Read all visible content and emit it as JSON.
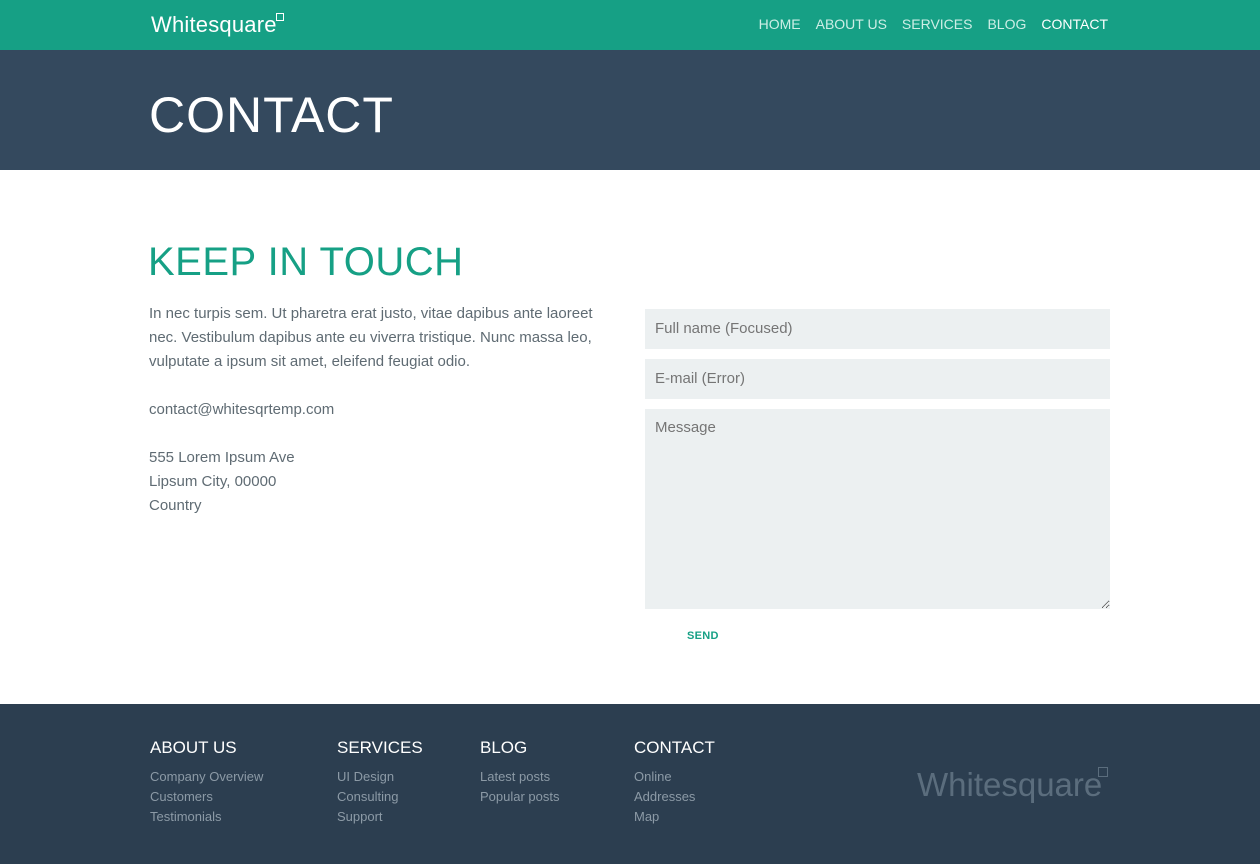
{
  "navbar": {
    "brand": "Whitesquare",
    "items": [
      {
        "label": "HOME",
        "active": false
      },
      {
        "label": "ABOUT US",
        "active": false
      },
      {
        "label": "SERVICES",
        "active": false
      },
      {
        "label": "BLOG",
        "active": false
      },
      {
        "label": "CONTACT",
        "active": true
      }
    ]
  },
  "header": {
    "title": "CONTACT"
  },
  "main": {
    "heading": "KEEP IN TOUCH",
    "description": "In nec turpis sem. Ut pharetra erat justo, vitae dapibus ante laoreet nec. Vestibulum dapibus ante eu viverra tristique. Nunc massa leo, vulputate a ipsum sit amet, eleifend feugiat odio.",
    "email": "contact@whitesqrtemp.com",
    "address": [
      "555 Lorem Ipsum Ave",
      "Lipsum City, 00000",
      "Country"
    ],
    "form": {
      "fullname_placeholder": "Full name (Focused)",
      "email_placeholder": "E-mail (Error)",
      "message_placeholder": "Message",
      "send_label": "SEND"
    }
  },
  "footer": {
    "columns": [
      {
        "title": "ABOUT US",
        "links": [
          "Company Overview",
          "Customers",
          "Testimonials"
        ]
      },
      {
        "title": "SERVICES",
        "links": [
          "UI Design",
          "Consulting",
          "Support"
        ]
      },
      {
        "title": "BLOG",
        "links": [
          "Latest posts",
          "Popular posts"
        ]
      },
      {
        "title": "CONTACT",
        "links": [
          "Online",
          "Addresses",
          "Map"
        ]
      }
    ],
    "brand": "Whitesquare"
  },
  "colors": {
    "accent": "#16a085",
    "header_bg": "#34495e",
    "footer_bg": "#2c3e50",
    "field_bg": "#ecf0f1"
  }
}
